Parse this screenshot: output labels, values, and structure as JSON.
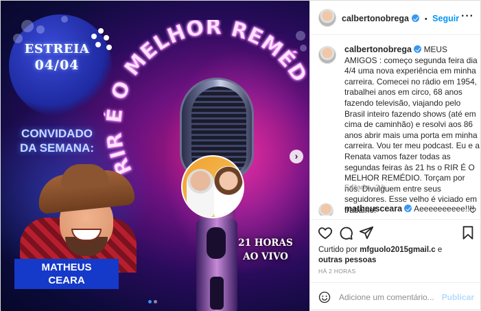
{
  "post": {
    "image": {
      "estreia_label": "ESTREIA",
      "estreia_date": "04/04",
      "guest_heading_1": "CONVIDADO",
      "guest_heading_2": "DA SEMANA:",
      "show_title": "RIR É O MELHOR REMÉDIO",
      "guest_name_1": "MATHEUS",
      "guest_name_2": "CEARA",
      "time_line_1": "21 HORAS",
      "time_line_2": "AO VIVO",
      "next_icon": "chevron-right-icon",
      "carousel_slide": 1,
      "carousel_total": 2
    },
    "header": {
      "username": "calbertonobrega",
      "separator": "•",
      "follow_label": "Seguir",
      "more_icon": "more-horizontal-icon"
    },
    "caption": {
      "username": "calbertonobrega",
      "text": "MEUS AMIGOS : começo segunda feira dia 4/4 uma nova experiência em minha carreira. Comecei no rádio em 1954, trabalhei anos em circo, 68 anos fazendo televisão, viajando pelo Brasil inteiro fazendo shows (até em cima de caminhão) e resolvi aos 86 anos abrir mais uma porta em minha carreira. Vou ter meu podcast. Eu e a Renata vamos fazer todas as segundas feiras às 21 hs o RIR É O MELHOR REMÉDIO. Torçam por nós. Divulguem entre seus seguidores. Esse velho é viciado em trabalho!",
      "edited": "Editado · 2 h"
    },
    "comment": {
      "username": "matheusceara",
      "text": "Aeeeeeeeeee!!!!"
    },
    "actions": {
      "like_icon": "heart-icon",
      "comment_icon": "comment-icon",
      "share_icon": "send-icon",
      "save_icon": "bookmark-icon"
    },
    "likes": {
      "prefix": "Curtido por ",
      "user": "mfguolo2015gmail.c",
      "suffix": " e",
      "others": "outras pessoas"
    },
    "timestamp": "HÁ 2 HORAS",
    "add_comment": {
      "emoji_icon": "emoji-icon",
      "placeholder": "Adicione um comentário...",
      "publish_label": "Publicar"
    }
  },
  "colors": {
    "link_blue": "#0095f6",
    "verified_blue": "#3897f0",
    "publish_disabled": "#b3dbff",
    "name_box_blue": "#1539c9"
  }
}
